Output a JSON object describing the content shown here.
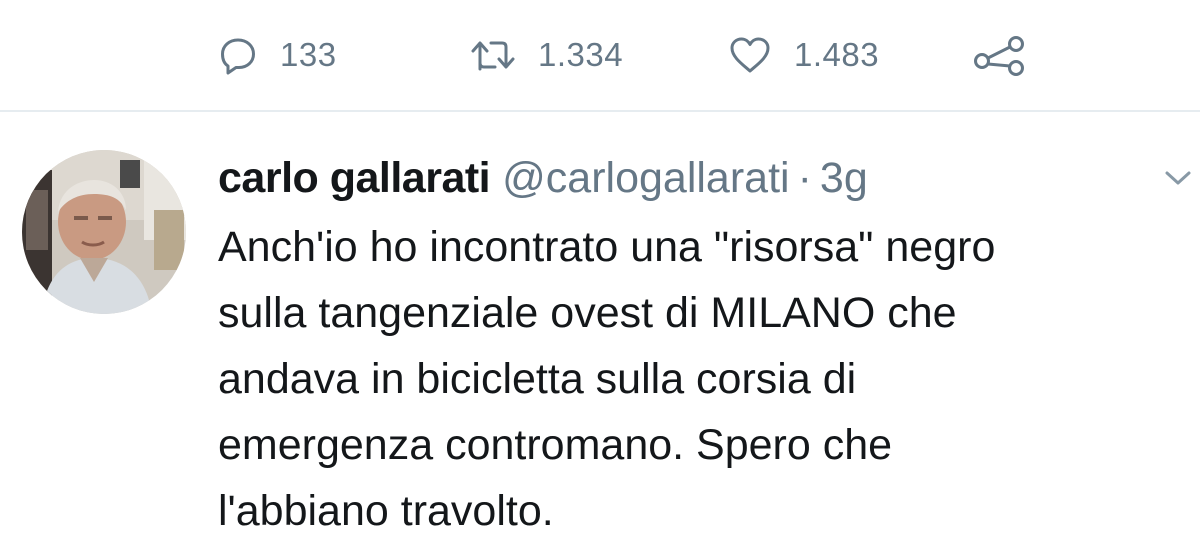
{
  "actions": {
    "reply": {
      "icon": "reply-icon",
      "count": "133"
    },
    "retweet": {
      "icon": "retweet-icon",
      "count": "1.334"
    },
    "like": {
      "icon": "heart-icon",
      "count": "1.483"
    },
    "share": {
      "icon": "share-icon"
    }
  },
  "tweet": {
    "author": {
      "display_name": "carlo gallarati",
      "handle": "@carlogallarati"
    },
    "separator": "·",
    "time": "3g",
    "lines": [
      "Anch'io ho incontrato una \"risorsa\" negro",
      "sulla tangenziale ovest di MILANO che",
      "andava in bicicletta sulla corsia di",
      "emergenza contromano. Spero che",
      "l'abbiano travolto."
    ]
  },
  "colors": {
    "text": "#14171a",
    "secondary": "#657786",
    "divider": "#e6ecf0"
  }
}
